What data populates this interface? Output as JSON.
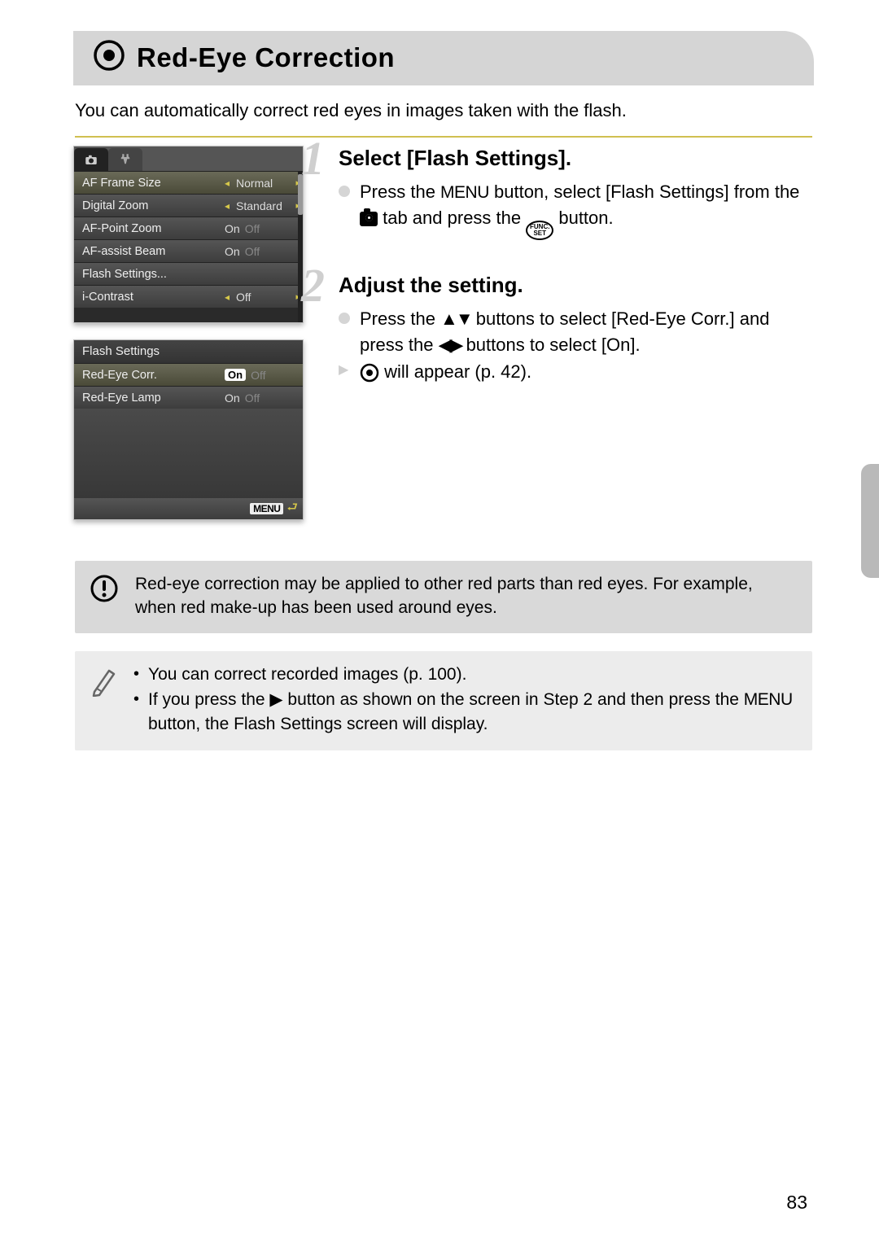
{
  "title": "Red-Eye Correction",
  "intro": "You can automatically correct red eyes in images taken with the flash.",
  "lcd1": {
    "rows": [
      {
        "label": "AF Frame Size",
        "val": "Normal",
        "sel": true,
        "caret": true,
        "arrow": true
      },
      {
        "label": "Digital Zoom",
        "val": "Standard",
        "caret": true,
        "arrow": true
      },
      {
        "label": "AF-Point Zoom",
        "on": "On",
        "off": "Off",
        "onSel": true
      },
      {
        "label": "AF-assist Beam",
        "on": "On",
        "off": "Off",
        "onSel": true
      },
      {
        "label": "Flash Settings...",
        "val": ""
      },
      {
        "label": "i-Contrast",
        "val": "Off",
        "caret": true,
        "arrow": true
      }
    ]
  },
  "lcd2": {
    "header": "Flash Settings",
    "rows": [
      {
        "label": "Red-Eye Corr.",
        "on": "On",
        "off": "Off",
        "onBox": true,
        "sel": true
      },
      {
        "label": "Red-Eye Lamp",
        "on": "On",
        "off": "Off",
        "onSel": true
      }
    ],
    "menu": "MENU"
  },
  "steps": [
    {
      "num": "1",
      "title": "Select [Flash Settings].",
      "body_parts": [
        "Press the ",
        "MENU",
        " button, select [Flash Settings] from the ",
        "CAM",
        " tab and press the ",
        "FUNC",
        " button."
      ]
    },
    {
      "num": "2",
      "title": "Adjust the setting.",
      "body_parts": [
        "Press the ",
        "UD",
        " buttons to select [Red-Eye Corr.] and press the ",
        "LR",
        " buttons to select [On]."
      ],
      "result_parts": [
        "EYE",
        " will appear (p. 42)."
      ]
    }
  ],
  "warning": "Red-eye correction may be applied to other red parts than red eyes. For example, when red make-up has been used around eyes.",
  "tips": [
    "You can correct recorded images (p. 100).",
    [
      "If you press the ",
      "RT",
      " button as shown on the screen in Step 2 and then press the ",
      "MENU",
      " button, the Flash Settings screen will display."
    ]
  ],
  "page_number": "83",
  "func_label_top": "FUNC.",
  "func_label_bot": "SET"
}
